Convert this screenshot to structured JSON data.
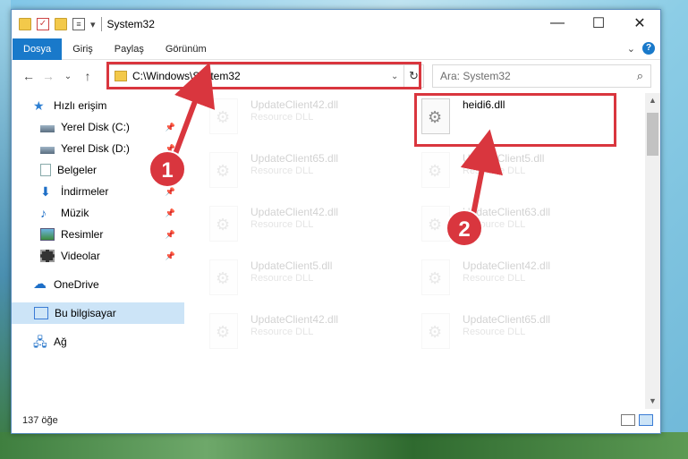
{
  "window": {
    "title": "System32",
    "controls": {
      "minimize": "—",
      "maximize": "☐",
      "close": "✕"
    }
  },
  "ribbon": {
    "tabs": [
      "Dosya",
      "Giriş",
      "Paylaş",
      "Görünüm"
    ],
    "active_tab": "Dosya",
    "collapse_glyph": "⌄",
    "help_glyph": "?"
  },
  "navigation": {
    "back": "←",
    "forward": "→",
    "recent": "⌄",
    "up": "↑",
    "address": "C:\\Windows\\System32",
    "address_dropdown": "⌄",
    "refresh": "↻",
    "search_placeholder": "Ara: System32"
  },
  "sidebar": {
    "items": [
      {
        "label": "Hızlı erişim",
        "icon": "star-icon"
      },
      {
        "label": "Yerel Disk (C:)",
        "icon": "drive-icon",
        "pinned": true
      },
      {
        "label": "Yerel Disk (D:)",
        "icon": "drive-icon",
        "pinned": true
      },
      {
        "label": "Belgeler",
        "icon": "documents-icon",
        "pinned": true
      },
      {
        "label": "İndirmeler",
        "icon": "downloads-icon",
        "pinned": true
      },
      {
        "label": "Müzik",
        "icon": "music-icon",
        "pinned": true
      },
      {
        "label": "Resimler",
        "icon": "pictures-icon",
        "pinned": true
      },
      {
        "label": "Videolar",
        "icon": "videos-icon",
        "pinned": true
      },
      {
        "label": "OneDrive",
        "icon": "onedrive-icon"
      },
      {
        "label": "Bu bilgisayar",
        "icon": "computer-icon",
        "selected": true
      },
      {
        "label": "Ağ",
        "icon": "network-icon"
      }
    ]
  },
  "files": {
    "left_column": [
      {
        "name": "UpdateClient42.dll",
        "type": "Resource DLL"
      },
      {
        "name": "UpdateClient65.dll",
        "type": "Resource DLL"
      },
      {
        "name": "UpdateClient42.dll",
        "type": "Resource DLL"
      },
      {
        "name": "UpdateClient5.dll",
        "type": "Resource DLL"
      },
      {
        "name": "UpdateClient42.dll",
        "type": "Resource DLL"
      }
    ],
    "right_column": [
      {
        "name": "heidi6.dll",
        "type": ""
      },
      {
        "name": "UpdateClient5.dll",
        "type": "Resource DLL"
      },
      {
        "name": "UpdateClient63.dll",
        "type": "Resource DLL"
      },
      {
        "name": "UpdateClient42.dll",
        "type": "Resource DLL"
      },
      {
        "name": "UpdateClient65.dll",
        "type": "Resource DLL"
      }
    ]
  },
  "status": {
    "count": "137 öğe"
  },
  "annotations": {
    "step1": "1",
    "step2": "2",
    "highlight_color": "#d9363e"
  }
}
